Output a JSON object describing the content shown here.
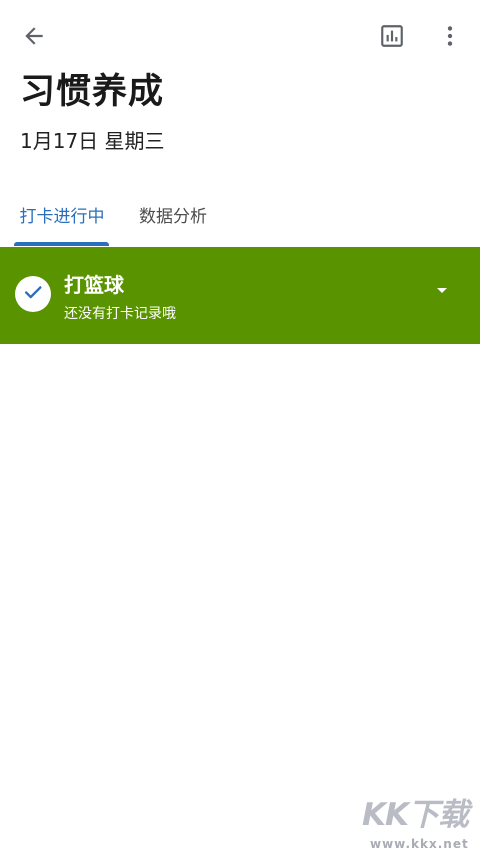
{
  "header": {
    "back_icon": "arrow-left-icon",
    "stats_icon": "bar-chart-icon",
    "more_icon": "more-vertical-icon",
    "title": "习惯养成",
    "date": "1月17日 星期三"
  },
  "tabs": [
    {
      "label": "打卡进行中",
      "active": true
    },
    {
      "label": "数据分析",
      "active": false
    }
  ],
  "habits": [
    {
      "name": "打篮球",
      "subtitle": "还没有打卡记录哦",
      "checked": true,
      "color": "#599300"
    }
  ],
  "colors": {
    "accent": "#2a6fbb",
    "habit_card": "#599300",
    "check_mark": "#2a6fbb"
  },
  "watermark": {
    "logo": "KK下载",
    "url": "www.kkx.net"
  }
}
